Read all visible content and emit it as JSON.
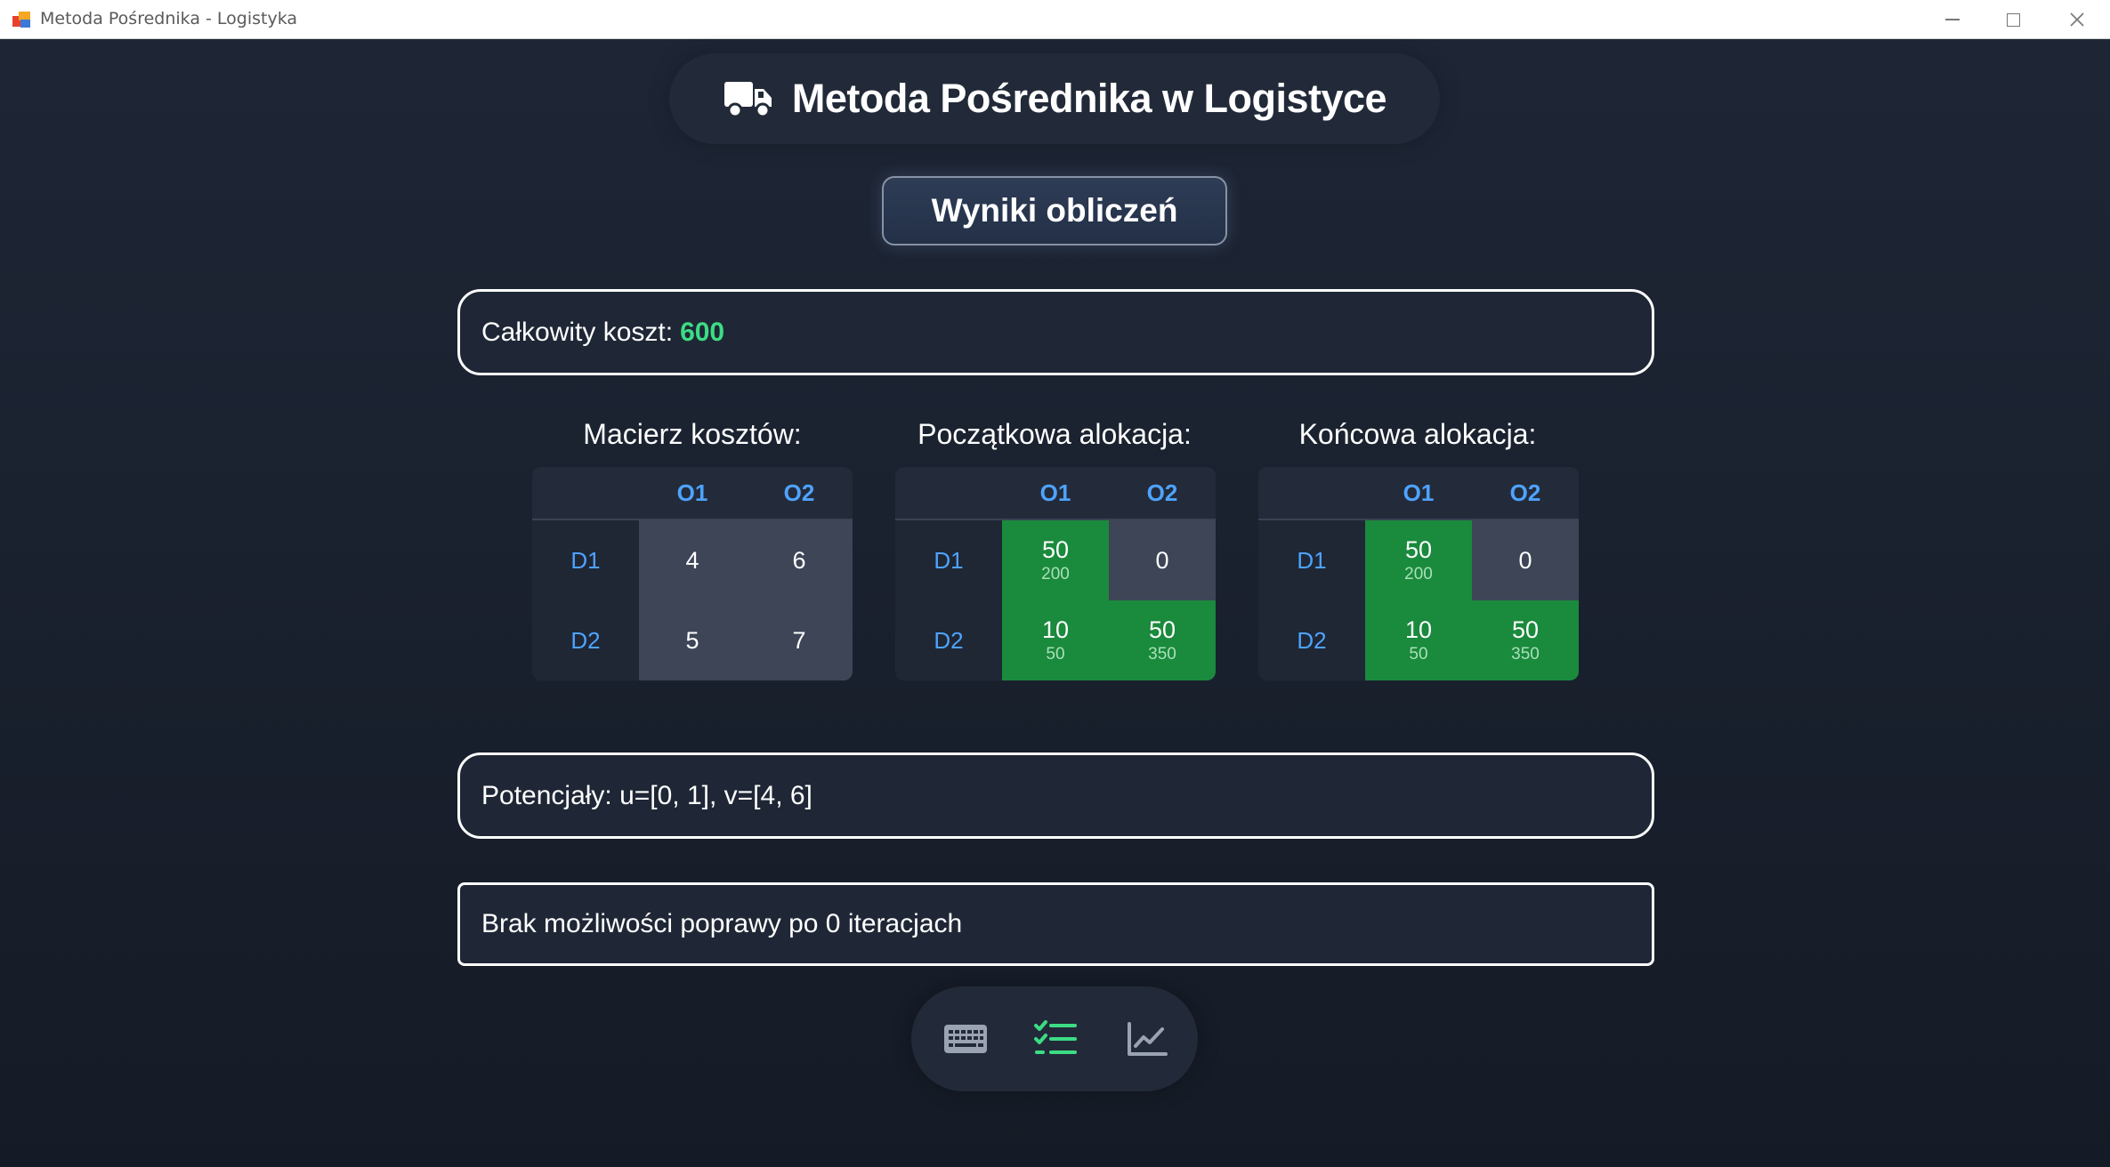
{
  "window": {
    "title": "Metoda Pośrednika - Logistyka"
  },
  "header": {
    "title": "Metoda Pośrednika w Logistyce",
    "icon": "truck-icon"
  },
  "results_label": "Wyniki obliczeń",
  "cost": {
    "label": "Całkowity koszt:",
    "value": "600"
  },
  "matrices": [
    {
      "title": "Macierz kosztów:",
      "columns": [
        "O1",
        "O2"
      ],
      "rows": [
        {
          "label": "D1",
          "cells": [
            {
              "value": "4"
            },
            {
              "value": "6"
            }
          ]
        },
        {
          "label": "D2",
          "cells": [
            {
              "value": "5"
            },
            {
              "value": "7"
            }
          ]
        }
      ]
    },
    {
      "title": "Początkowa alokacja:",
      "columns": [
        "O1",
        "O2"
      ],
      "rows": [
        {
          "label": "D1",
          "cells": [
            {
              "value": "50",
              "sub": "200"
            },
            {
              "value": "0"
            }
          ]
        },
        {
          "label": "D2",
          "cells": [
            {
              "value": "10",
              "sub": "50"
            },
            {
              "value": "50",
              "sub": "350"
            }
          ]
        }
      ]
    },
    {
      "title": "Końcowa alokacja:",
      "columns": [
        "O1",
        "O2"
      ],
      "rows": [
        {
          "label": "D1",
          "cells": [
            {
              "value": "50",
              "sub": "200"
            },
            {
              "value": "0"
            }
          ]
        },
        {
          "label": "D2",
          "cells": [
            {
              "value": "10",
              "sub": "50"
            },
            {
              "value": "50",
              "sub": "350"
            }
          ]
        }
      ]
    }
  ],
  "potentials": "Potencjały: u=[0, 1], v=[4, 6]",
  "status": "Brak możliwości poprawy po 0 iteracjach",
  "bottom_nav": [
    {
      "icon": "keyboard-icon",
      "active": false
    },
    {
      "icon": "checklist-icon",
      "active": true
    },
    {
      "icon": "line-chart-icon",
      "active": false
    }
  ],
  "colors": {
    "accent_green": "#3ddc84",
    "allocation_green": "#1a8a3c",
    "header_blue": "#4ea3ff",
    "background": "#1b2332"
  }
}
